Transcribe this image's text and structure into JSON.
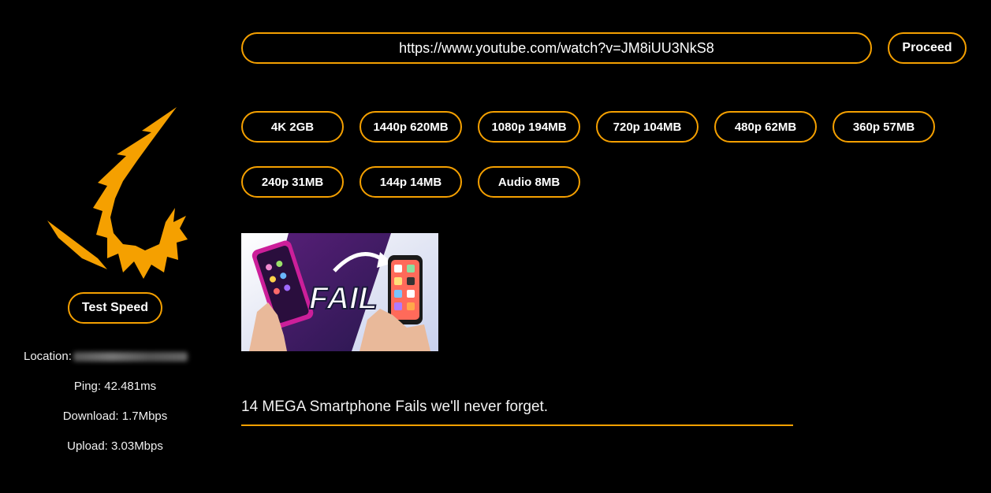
{
  "sidebar": {
    "test_speed_label": "Test Speed",
    "location_label": "Location:",
    "ping": "Ping: 42.481ms",
    "download": "Download: 1.7Mbps",
    "upload": "Upload: 3.03Mbps"
  },
  "url_bar": {
    "value": "https://www.youtube.com/watch?v=JM8iUU3NkS8",
    "proceed_label": "Proceed"
  },
  "formats": [
    {
      "label": "4K 2GB"
    },
    {
      "label": "1440p 620MB"
    },
    {
      "label": "1080p 194MB"
    },
    {
      "label": "720p 104MB"
    },
    {
      "label": "480p 62MB"
    },
    {
      "label": "360p 57MB"
    },
    {
      "label": "240p 31MB"
    },
    {
      "label": "144p 14MB"
    },
    {
      "label": "Audio 8MB"
    }
  ],
  "thumbnail": {
    "text": "FAIL"
  },
  "video": {
    "title": "14 MEGA Smartphone Fails we'll never forget."
  },
  "colors": {
    "accent": "#f5a000",
    "background": "#000000",
    "text": "#ffffff"
  }
}
